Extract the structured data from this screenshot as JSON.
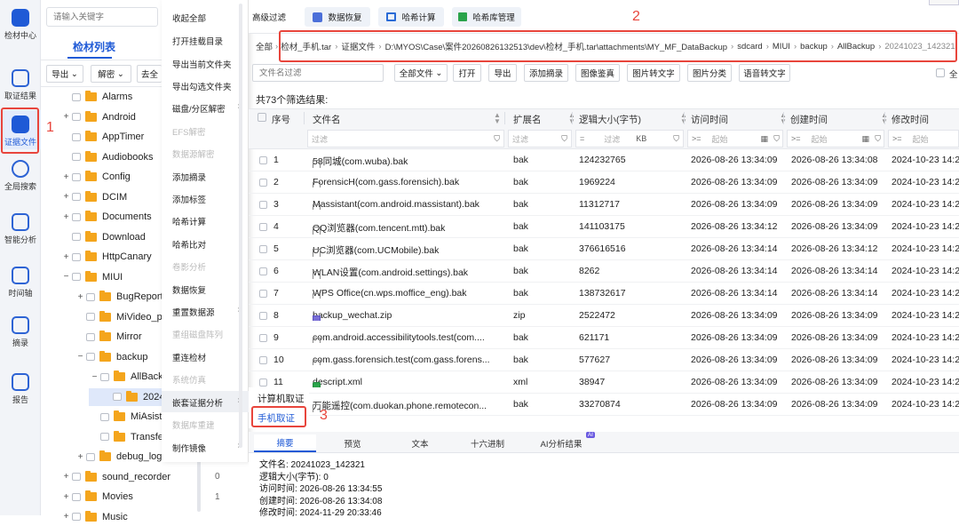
{
  "rail": {
    "items": [
      {
        "label": "检材中心",
        "icon": "home-icon"
      },
      {
        "label": "取证结果",
        "icon": "result-icon"
      },
      {
        "label": "证据文件",
        "icon": "evidence-file-icon"
      },
      {
        "label": "全局搜索",
        "icon": "search-icon"
      },
      {
        "label": "智能分析",
        "icon": "analysis-icon"
      },
      {
        "label": "时间轴",
        "icon": "timeline-icon"
      },
      {
        "label": "摘录",
        "icon": "star-icon"
      },
      {
        "label": "报告",
        "icon": "report-icon"
      }
    ]
  },
  "annotations": {
    "n1": "1",
    "n2": "2",
    "n3": "3"
  },
  "tree": {
    "search_placeholder": "请输入关键字",
    "title": "检材列表",
    "export_label": "导出",
    "decrypt_label": "解密",
    "more_label": "去全",
    "items": [
      {
        "label": "Alarms",
        "level": 0,
        "exp": ""
      },
      {
        "label": "Android",
        "level": 0,
        "exp": "+"
      },
      {
        "label": "AppTimer",
        "level": 0,
        "exp": ""
      },
      {
        "label": "Audiobooks",
        "level": 0,
        "exp": ""
      },
      {
        "label": "Config",
        "level": 0,
        "exp": "+"
      },
      {
        "label": "DCIM",
        "level": 0,
        "exp": "+"
      },
      {
        "label": "Documents",
        "level": 0,
        "exp": "+"
      },
      {
        "label": "Download",
        "level": 0,
        "exp": ""
      },
      {
        "label": "HttpCanary",
        "level": 0,
        "exp": "+"
      },
      {
        "label": "MIUI",
        "level": 0,
        "exp": "−"
      },
      {
        "label": "BugReports",
        "level": 1,
        "exp": "+"
      },
      {
        "label": "MiVideo_pi",
        "level": 1,
        "exp": ""
      },
      {
        "label": "Mirror",
        "level": 1,
        "exp": ""
      },
      {
        "label": "backup",
        "level": 1,
        "exp": "−"
      },
      {
        "label": "AllBackup",
        "level": 2,
        "exp": "−"
      },
      {
        "label": "20241023_",
        "level": 3,
        "exp": ""
      },
      {
        "label": "MiAsist",
        "level": 2,
        "exp": ""
      },
      {
        "label": "Transfer",
        "level": 2,
        "exp": ""
      },
      {
        "label": "debug_log",
        "level": 1,
        "exp": "+"
      },
      {
        "label": "sound_recorder",
        "level": 0,
        "exp": "+",
        "count": "0"
      },
      {
        "label": "Movies",
        "level": 0,
        "exp": "+",
        "count": "1"
      },
      {
        "label": "Music",
        "level": 0,
        "exp": "+"
      }
    ]
  },
  "menu": {
    "items": [
      {
        "label": "收起全部",
        "disabled": false
      },
      {
        "label": "打开挂载目录",
        "disabled": false
      },
      {
        "label": "导出当前文件夹",
        "disabled": false
      },
      {
        "label": "导出勾选文件夹",
        "disabled": false
      },
      {
        "label": "磁盘/分区解密",
        "disabled": false,
        "submenu": true
      },
      {
        "label": "EFS解密",
        "disabled": true
      },
      {
        "label": "数据源解密",
        "disabled": true
      },
      {
        "label": "添加摘录",
        "disabled": false
      },
      {
        "label": "添加标签",
        "disabled": false
      },
      {
        "label": "哈希计算",
        "disabled": false
      },
      {
        "label": "哈希比对",
        "disabled": false
      },
      {
        "label": "卷影分析",
        "disabled": true
      },
      {
        "label": "数据恢复",
        "disabled": false
      },
      {
        "label": "重置数据源",
        "disabled": false,
        "submenu": true
      },
      {
        "label": "重组磁盘阵列",
        "disabled": true
      },
      {
        "label": "重连检材",
        "disabled": false
      },
      {
        "label": "系统仿真",
        "disabled": true
      },
      {
        "label": "嵌套证据分析",
        "disabled": false,
        "submenu": true,
        "highlight": true
      },
      {
        "label": "数据库重建",
        "disabled": true
      },
      {
        "label": "制作镜像",
        "disabled": false,
        "submenu": true
      }
    ],
    "submenu": {
      "computer": "计算机取证",
      "phone": "手机取证"
    }
  },
  "toolbar": {
    "advanced_filter": "高级过滤",
    "data_recovery": "数据恢复",
    "hash_calc": "哈希计算",
    "hash_db": "哈希库管理"
  },
  "breadcrumb": {
    "root": "全部",
    "parts": [
      "检材_手机.tar",
      "证据文件",
      "D:\\MYOS\\Case\\案件20260826132513\\dev\\检材_手机.tar\\attachments\\MY_MF_DataBackup",
      "sdcard",
      "MIUI",
      "backup",
      "AllBackup",
      "20241023_142321"
    ]
  },
  "actions": {
    "filename_filter_placeholder": "文件名过滤",
    "all_files": "全部文件",
    "open": "打开",
    "export": "导出",
    "add_excerpt": "添加摘录",
    "image_review": "图像鉴真",
    "image_to_text": "图片转文字",
    "image_classify": "图片分类",
    "voice_to_text": "语音转文字",
    "select_all": "全"
  },
  "result_count": "共73个筛选结果:",
  "table": {
    "headers": {
      "seq": "序号",
      "name": "文件名",
      "ext": "扩展名",
      "size": "逻辑大小(字节)",
      "atime": "访问时间",
      "ctime": "创建时间",
      "mtime": "修改时间"
    },
    "filter": {
      "text": "过滤",
      "eq": "=",
      "kb": "KB",
      "ge": ">=",
      "start": "起始"
    },
    "rows": [
      {
        "seq": "1",
        "name": "58同城(com.wuba).bak",
        "ext": "bak",
        "size": "124232765",
        "atime": "2026-08-26 13:34:09",
        "ctime": "2026-08-26 13:34:08",
        "mtime": "2024-10-23 14:2",
        "icon": "doc"
      },
      {
        "seq": "2",
        "name": "ForensicH(com.gass.forensich).bak",
        "ext": "bak",
        "size": "1969224",
        "atime": "2026-08-26 13:34:09",
        "ctime": "2026-08-26 13:34:09",
        "mtime": "2024-10-23 14:2",
        "icon": "doc"
      },
      {
        "seq": "3",
        "name": "Massistant(com.android.massistant).bak",
        "ext": "bak",
        "size": "11312717",
        "atime": "2026-08-26 13:34:09",
        "ctime": "2026-08-26 13:34:09",
        "mtime": "2024-10-23 14:2",
        "icon": "doc"
      },
      {
        "seq": "4",
        "name": "QQ浏览器(com.tencent.mtt).bak",
        "ext": "bak",
        "size": "141103175",
        "atime": "2026-08-26 13:34:12",
        "ctime": "2026-08-26 13:34:09",
        "mtime": "2024-10-23 14:2",
        "icon": "doc"
      },
      {
        "seq": "5",
        "name": "UC浏览器(com.UCMobile).bak",
        "ext": "bak",
        "size": "376616516",
        "atime": "2026-08-26 13:34:14",
        "ctime": "2026-08-26 13:34:12",
        "mtime": "2024-10-23 14:2",
        "icon": "doc"
      },
      {
        "seq": "6",
        "name": "WLAN设置(com.android.settings).bak",
        "ext": "bak",
        "size": "8262",
        "atime": "2026-08-26 13:34:14",
        "ctime": "2026-08-26 13:34:14",
        "mtime": "2024-10-23 14:2",
        "icon": "doc"
      },
      {
        "seq": "7",
        "name": "WPS Office(cn.wps.moffice_eng).bak",
        "ext": "bak",
        "size": "138732617",
        "atime": "2026-08-26 13:34:14",
        "ctime": "2026-08-26 13:34:14",
        "mtime": "2024-10-23 14:2",
        "icon": "doc"
      },
      {
        "seq": "8",
        "name": "backup_wechat.zip",
        "ext": "zip",
        "size": "2522472",
        "atime": "2026-08-26 13:34:09",
        "ctime": "2026-08-26 13:34:09",
        "mtime": "2024-10-23 14:2",
        "icon": "zip"
      },
      {
        "seq": "9",
        "name": "com.android.accessibilitytools.test(com....",
        "ext": "bak",
        "size": "621171",
        "atime": "2026-08-26 13:34:09",
        "ctime": "2026-08-26 13:34:09",
        "mtime": "2024-10-23 14:2",
        "icon": "doc"
      },
      {
        "seq": "10",
        "name": "com.gass.forensich.test(com.gass.forens...",
        "ext": "bak",
        "size": "577627",
        "atime": "2026-08-26 13:34:09",
        "ctime": "2026-08-26 13:34:09",
        "mtime": "2024-10-23 14:2",
        "icon": "doc"
      },
      {
        "seq": "11",
        "name": "descript.xml",
        "ext": "xml",
        "size": "38947",
        "atime": "2026-08-26 13:34:09",
        "ctime": "2026-08-26 13:34:09",
        "mtime": "2024-10-23 14:2",
        "icon": "xml"
      },
      {
        "seq": "",
        "name": "万能遥控(com.duokan.phone.remotecon...",
        "ext": "bak",
        "size": "33270874",
        "atime": "2026-08-26 13:34:09",
        "ctime": "2026-08-26 13:34:09",
        "mtime": "2024-10-23 14:2",
        "icon": "doc"
      }
    ]
  },
  "bottom": {
    "tabs": [
      "摘要",
      "预览",
      "文本",
      "十六进制",
      "AI分析结果"
    ],
    "ai_badge": "AI",
    "info": [
      "文件名:  20241023_142321",
      "逻辑大小(字节):  0",
      "访问时间:  2026-08-26 13:34:55",
      "创建时间:  2026-08-26 13:34:08",
      "修改时间:  2024-11-29 20:33:46"
    ]
  },
  "colors": {
    "accent": "#1f5ad6",
    "annotation": "#e8453c",
    "folder": "#f4a51c"
  }
}
